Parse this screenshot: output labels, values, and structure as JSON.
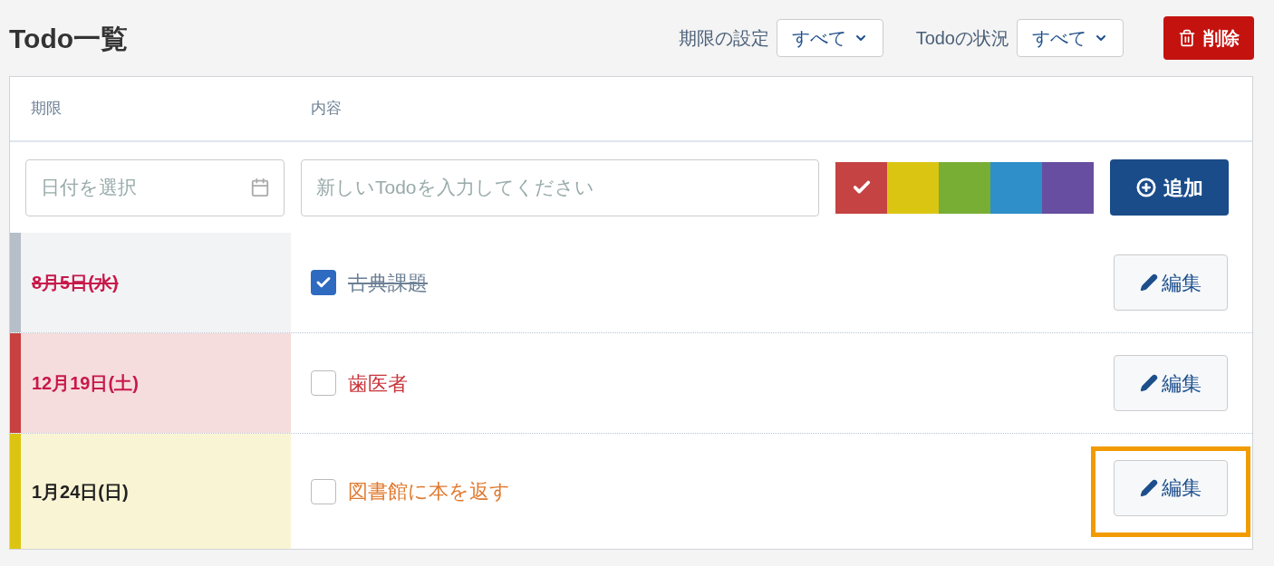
{
  "title": "Todo一覧",
  "filters": [
    {
      "label": "期限の設定",
      "value": "すべて"
    },
    {
      "label": "Todoの状況",
      "value": "すべて"
    }
  ],
  "delete_button": "削除",
  "columns": [
    "期限",
    "内容"
  ],
  "new_todo": {
    "date_placeholder": "日付を選択",
    "text_placeholder": "新しいTodoを入力してください",
    "add_button": "追加"
  },
  "swatches": [
    {
      "color": "#c54343",
      "selected": true
    },
    {
      "color": "#dbc513",
      "selected": false
    },
    {
      "color": "#79ae35",
      "selected": false
    },
    {
      "color": "#2f8fc9",
      "selected": false
    },
    {
      "color": "#674ea0",
      "selected": false
    }
  ],
  "todos": [
    {
      "date": "8月5日(水)",
      "text": "古典課題",
      "done": true,
      "color": "#b6bec8",
      "kind": "completed",
      "edit": "編集",
      "highlighted": false
    },
    {
      "date": "12月19日(土)",
      "text": "歯医者",
      "done": false,
      "color": "#c94040",
      "kind": "urgent",
      "edit": "編集",
      "highlighted": false
    },
    {
      "date": "1月24日(日)",
      "text": "図書館に本を返す",
      "done": false,
      "color": "#dcc511",
      "kind": "normal",
      "edit": "編集",
      "highlighted": true
    }
  ]
}
